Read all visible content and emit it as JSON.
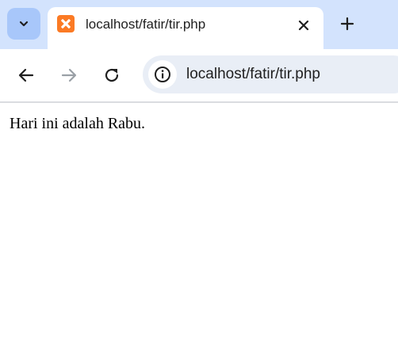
{
  "browser": {
    "tab": {
      "title": "localhost/fatir/tir.php",
      "favicon": "xampp-icon",
      "favicon_color": "#fb7a24"
    },
    "icons": {
      "tab_search": "chevron-down-icon",
      "tab_close": "close-icon",
      "new_tab": "plus-icon",
      "back": "arrow-left-icon",
      "forward": "arrow-right-icon",
      "reload": "reload-icon",
      "site_info": "info-icon"
    },
    "address_bar": {
      "url": "localhost/fatir/tir.php"
    },
    "colors": {
      "tabstrip_bg": "#d3e3fd",
      "tab_search_bg": "#a8c7fa",
      "omnibox_bg": "#e9eef6"
    }
  },
  "page": {
    "text": "Hari ini adalah Rabu."
  }
}
